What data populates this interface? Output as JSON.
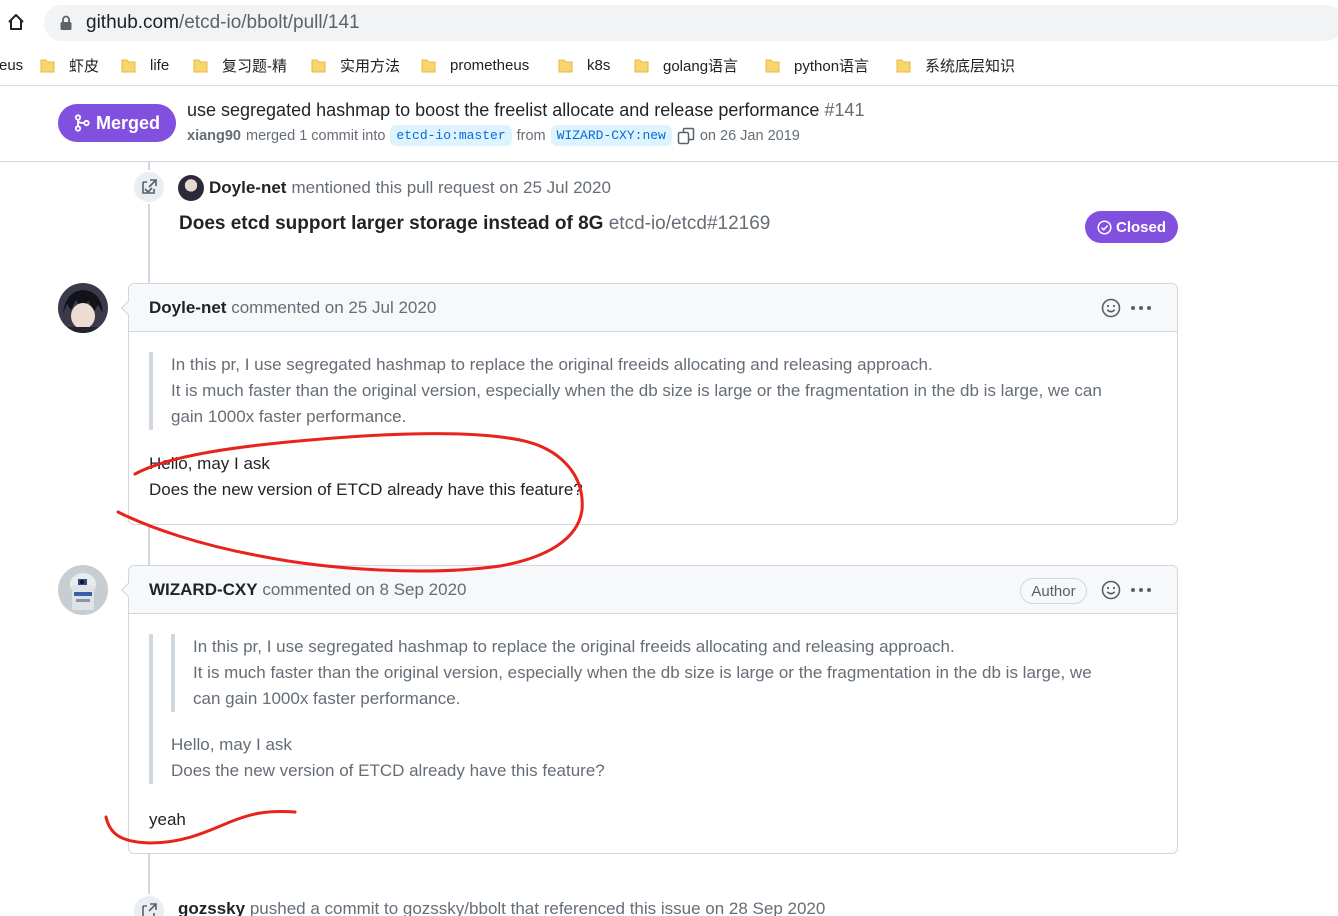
{
  "browser": {
    "url_host": "github.com",
    "url_path": "/etcd-io/bbolt/pull/141",
    "bookmarks": [
      "eus",
      "虾皮",
      "life",
      "复习题-精",
      "实用方法",
      "prometheus",
      "k8s",
      "golang语言",
      "python语言",
      "系统底层知识"
    ]
  },
  "pr": {
    "status": "Merged",
    "title": "use segregated hashmap to boost the freelist allocate and release performance",
    "number": "#141",
    "author": "xiang90",
    "merged_text": "merged 1 commit into",
    "base_branch": "etcd-io:master",
    "from_text": "from",
    "head_branch": "WIZARD-CXY:new",
    "date_text": "on 26 Jan 2019"
  },
  "mention_event": {
    "user": "Doyle-net",
    "text": "mentioned this pull request on 25 Jul 2020",
    "ref_title": "Does etcd support larger storage instead of 8G",
    "ref_id": "etcd-io/etcd#12169",
    "ref_status": "Closed"
  },
  "comments": [
    {
      "user": "Doyle-net",
      "action": "commented on 25 Jul 2020",
      "quote": [
        "In this pr, I use segregated hashmap to replace the original freeids allocating and releasing approach.",
        "It is much faster than the original version, especially when the db size is large or the fragmentation in the db is large, we can",
        "gain 1000x faster performance."
      ],
      "body": [
        "Hello, may I ask",
        "Does the new version of ETCD already have this feature?"
      ]
    },
    {
      "user": "WIZARD-CXY",
      "action": "commented on 8 Sep 2020",
      "badge": "Author",
      "quote": [
        "In this pr, I use segregated hashmap to replace the original freeids allocating and releasing approach.",
        "It is much faster than the original version, especially when the db size is large or the fragmentation in the db is large, we",
        "can gain 1000x faster performance."
      ],
      "quote2": [
        "Hello, may I ask",
        "Does the new version of ETCD already have this feature?"
      ],
      "body": "yeah"
    }
  ],
  "push_event": {
    "user": "gozssky",
    "text": "pushed a commit to gozssky/bbolt that referenced this issue on 28 Sep 2020"
  },
  "colors": {
    "merged_purple": "#8250df",
    "annotation_red": "#e8231c",
    "link_blue": "#0969da"
  },
  "icons": [
    "home-icon",
    "lock-icon",
    "folder-icon",
    "merge-icon",
    "copy-icon",
    "cross-reference-icon",
    "closed-check-icon",
    "smiley-icon",
    "kebab-icon"
  ]
}
